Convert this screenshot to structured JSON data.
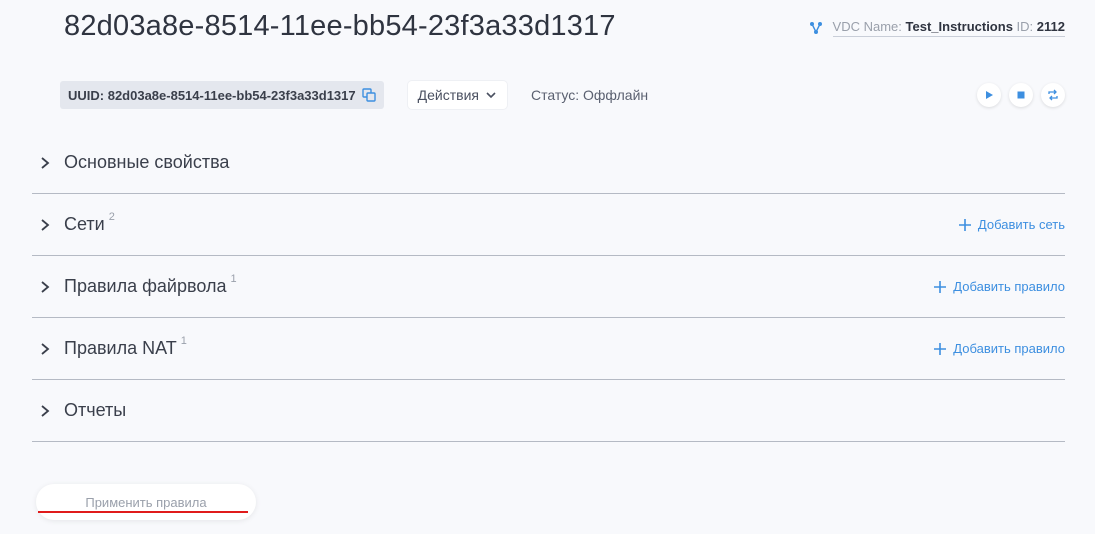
{
  "header": {
    "title": "82d03a8e-8514-11ee-bb54-23f3a33d1317",
    "vdc_name_label": "VDC Name:",
    "vdc_name_value": "Test_Instructions",
    "vdc_id_label": "ID:",
    "vdc_id_value": "2112",
    "vdc_icon": "network-icon"
  },
  "toolbar": {
    "uuid_text": "UUID: 82d03a8e-8514-11ee-bb54-23f3a33d1317",
    "actions_label": "Действия",
    "status_text": "Статус: Оффлайн",
    "controls": [
      "play-icon",
      "stop-icon",
      "restart-icon"
    ]
  },
  "sections": [
    {
      "label": "Основные свойства",
      "count": "",
      "action": ""
    },
    {
      "label": "Сети",
      "count": "2",
      "action": "Добавить сеть"
    },
    {
      "label": "Правила файрвола",
      "count": "1",
      "action": "Добавить правило"
    },
    {
      "label": "Правила NAT",
      "count": "1",
      "action": "Добавить правило"
    },
    {
      "label": "Отчеты",
      "count": "",
      "action": ""
    }
  ],
  "footer": {
    "apply_label": "Применить правила"
  },
  "colors": {
    "accent": "#3d8fe0",
    "highlight_underline": "#e01b1b"
  }
}
